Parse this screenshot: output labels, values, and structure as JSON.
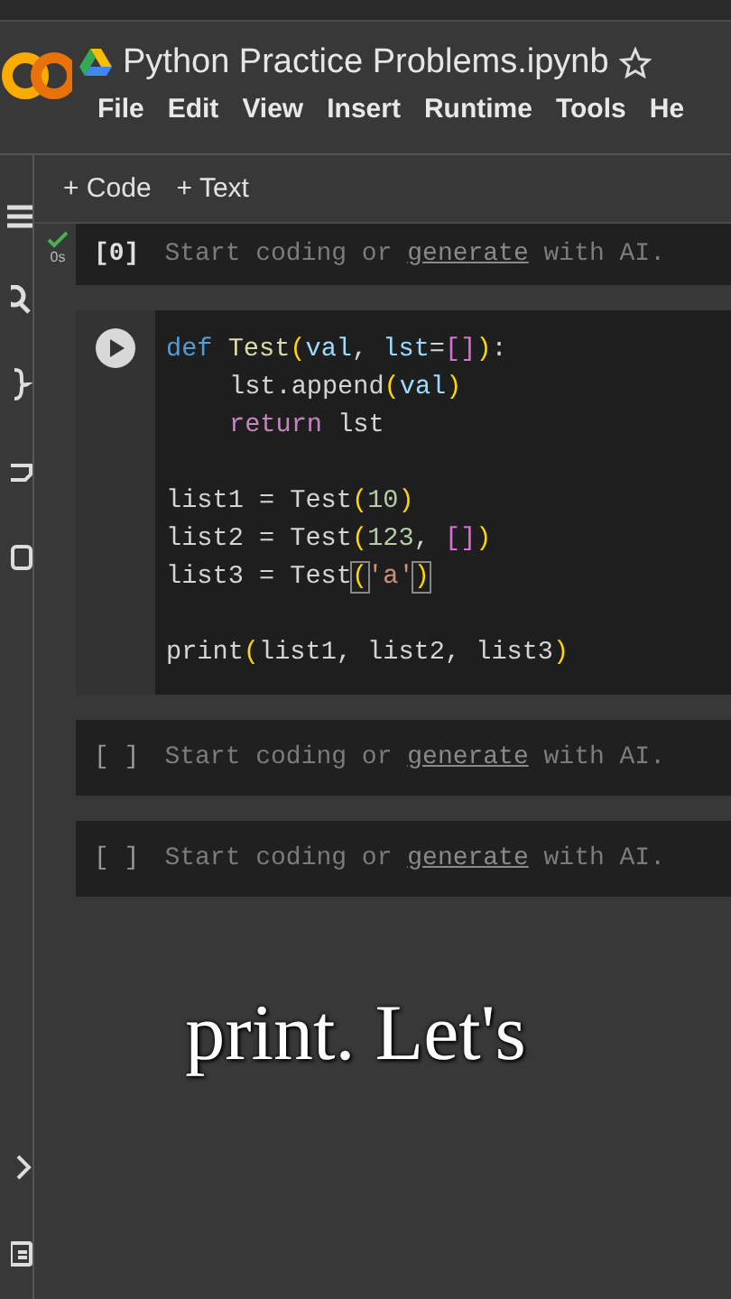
{
  "header": {
    "title": "Python Practice Problems.ipynb",
    "menu": [
      "File",
      "Edit",
      "View",
      "Insert",
      "Runtime",
      "Tools",
      "He"
    ]
  },
  "toolbar": [
    "+ Code",
    "+ Text"
  ],
  "cells": [
    {
      "kind": "empty",
      "prompt": "[0]",
      "executed": true,
      "duration": "0s",
      "hint": [
        "Start coding or ",
        "generate",
        " with AI."
      ]
    },
    {
      "kind": "code",
      "lines": [
        {
          "tokens": [
            {
              "text": "def ",
              "kind": "keyword"
            },
            {
              "text": "Test",
              "kind": "name"
            },
            {
              "text": "(",
              "kind": "paren"
            },
            {
              "text": "val",
              "kind": "param"
            },
            {
              "text": ", ",
              "kind": "plain"
            },
            {
              "text": "lst",
              "kind": "param"
            },
            {
              "text": "=",
              "kind": "plain"
            },
            {
              "text": "[]",
              "kind": "bracket"
            },
            {
              "text": ")",
              "kind": "paren"
            },
            {
              "text": ":",
              "kind": "plain"
            }
          ]
        },
        {
          "indent": true,
          "tokens": [
            {
              "text": "lst.append",
              "kind": "plain"
            },
            {
              "text": "(",
              "kind": "paren"
            },
            {
              "text": "val",
              "kind": "param"
            },
            {
              "text": ")",
              "kind": "paren"
            }
          ]
        },
        {
          "indent": true,
          "tokens": [
            {
              "text": "return ",
              "kind": "control"
            },
            {
              "text": "lst",
              "kind": "plain"
            }
          ]
        },
        {
          "kind": "blank"
        },
        {
          "tokens": [
            {
              "text": "list1 = Test",
              "kind": "plain"
            },
            {
              "text": "(",
              "kind": "paren"
            },
            {
              "text": "10",
              "kind": "number"
            },
            {
              "text": ")",
              "kind": "paren"
            }
          ]
        },
        {
          "tokens": [
            {
              "text": "list2 = Test",
              "kind": "plain"
            },
            {
              "text": "(",
              "kind": "paren"
            },
            {
              "text": "123",
              "kind": "number"
            },
            {
              "text": ", ",
              "kind": "plain"
            },
            {
              "text": "[]",
              "kind": "bracket"
            },
            {
              "text": ")",
              "kind": "paren"
            }
          ]
        },
        {
          "tokens": [
            {
              "text": "list3 = Test",
              "kind": "plain"
            },
            {
              "text": "(",
              "kind": "matched"
            },
            {
              "text": "'a'",
              "kind": "string"
            },
            {
              "text": ")",
              "kind": "matched"
            }
          ]
        },
        {
          "kind": "blank"
        },
        {
          "tokens": [
            {
              "text": "print",
              "kind": "plain"
            },
            {
              "text": "(",
              "kind": "paren"
            },
            {
              "text": "list1, list2, list3",
              "kind": "plain"
            },
            {
              "text": ")",
              "kind": "paren"
            }
          ]
        }
      ]
    },
    {
      "kind": "empty",
      "prompt": "[ ]",
      "executed": false,
      "hint": [
        "Start coding or ",
        "generate",
        " with AI."
      ]
    },
    {
      "kind": "empty",
      "prompt": "[ ]",
      "executed": false,
      "hint": [
        "Start coding or ",
        "generate",
        " with AI."
      ]
    }
  ],
  "caption": "print. Let's"
}
